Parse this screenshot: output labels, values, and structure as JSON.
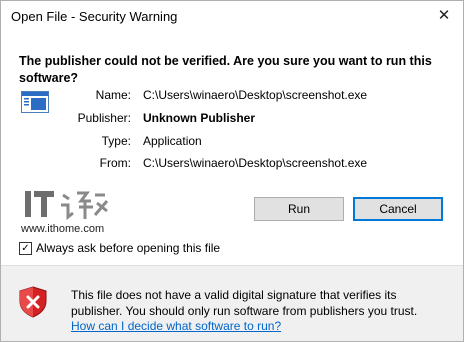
{
  "window": {
    "title": "Open File - Security Warning",
    "close_glyph": "✕"
  },
  "dialog": {
    "question": "The publisher could not be verified.  Are you sure you want to run this software?",
    "fields": [
      {
        "label": "Name:",
        "value": "C:\\Users\\winaero\\Desktop\\screenshot.exe",
        "bold": false
      },
      {
        "label": "Publisher:",
        "value": "Unknown Publisher",
        "bold": true
      },
      {
        "label": "Type:",
        "value": "Application",
        "bold": false
      },
      {
        "label": "From:",
        "value": "C:\\Users\\winaero\\Desktop\\screenshot.exe",
        "bold": false
      }
    ],
    "file_icon": "application-window-icon"
  },
  "watermark": {
    "logo_icon": "ithome-logo",
    "site": "www.ithome.com"
  },
  "buttons": {
    "run_label": "Run",
    "cancel_label": "Cancel"
  },
  "checkbox": {
    "label": "Always ask before opening this file",
    "checked": true,
    "check_glyph": "✓"
  },
  "footer": {
    "warning_icon": "shield-error-icon",
    "text": "This file does not have a valid digital signature that verifies its publisher.  You should only run software from publishers you trust.",
    "help_link": "How can I decide what software to run?"
  },
  "colors": {
    "link": "#0066cc",
    "shield_red": "#d42121",
    "focus_border": "#0078d7",
    "footer_bg": "#f0f0f0"
  }
}
